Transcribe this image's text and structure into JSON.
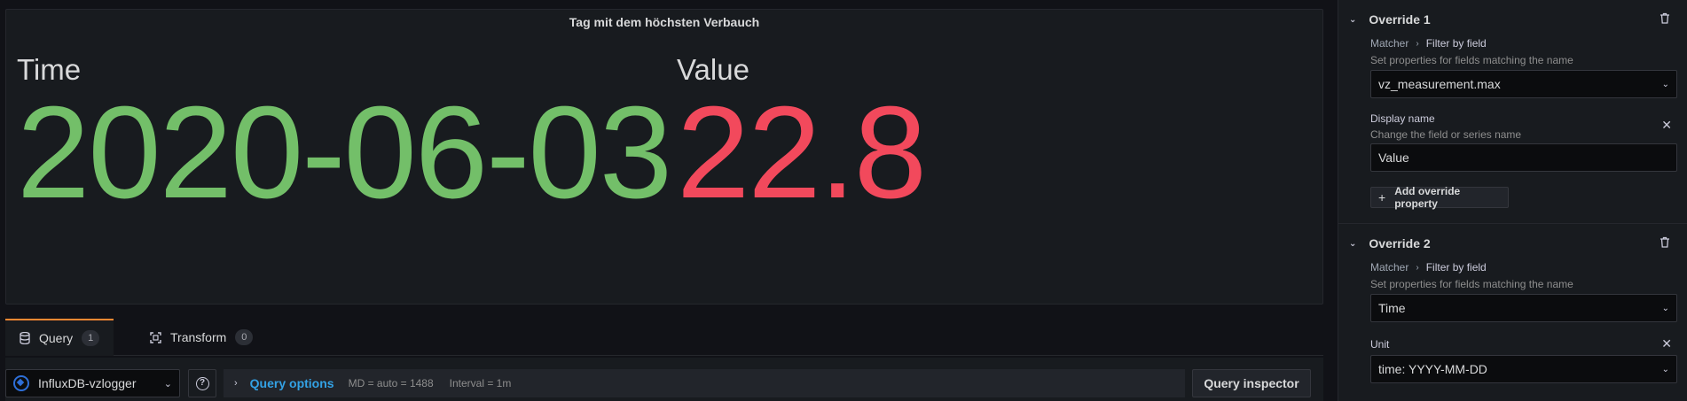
{
  "panel": {
    "title": "Tag mit dem höchsten Verbauch",
    "stats": [
      {
        "label": "Time",
        "value": "2020-06-03",
        "color": "#73bf69"
      },
      {
        "label": "Value",
        "value": "22.8",
        "color": "#f2495c"
      }
    ]
  },
  "tabs": [
    {
      "label": "Query",
      "count": "1",
      "icon": "database-icon"
    },
    {
      "label": "Transform",
      "count": "0",
      "icon": "transform-icon"
    }
  ],
  "query_row": {
    "datasource": "InfluxDB-vzlogger",
    "options_title": "Query options",
    "md": "MD = auto = 1488",
    "interval": "Interval = 1m",
    "inspector": "Query inspector"
  },
  "overrides": [
    {
      "title": "Override 1",
      "matcher": "Matcher",
      "matcher_type": "Filter by field",
      "matcher_desc": "Set properties for fields matching the name",
      "matcher_value": "vz_measurement.max",
      "property_label": "Display name",
      "property_desc": "Change the field or series name",
      "property_value": "Value",
      "add_property": "Add override property"
    },
    {
      "title": "Override 2",
      "matcher": "Matcher",
      "matcher_type": "Filter by field",
      "matcher_desc": "Set properties for fields matching the name",
      "matcher_value": "Time",
      "property_label": "Unit",
      "property_value": "time: YYYY-MM-DD"
    }
  ]
}
